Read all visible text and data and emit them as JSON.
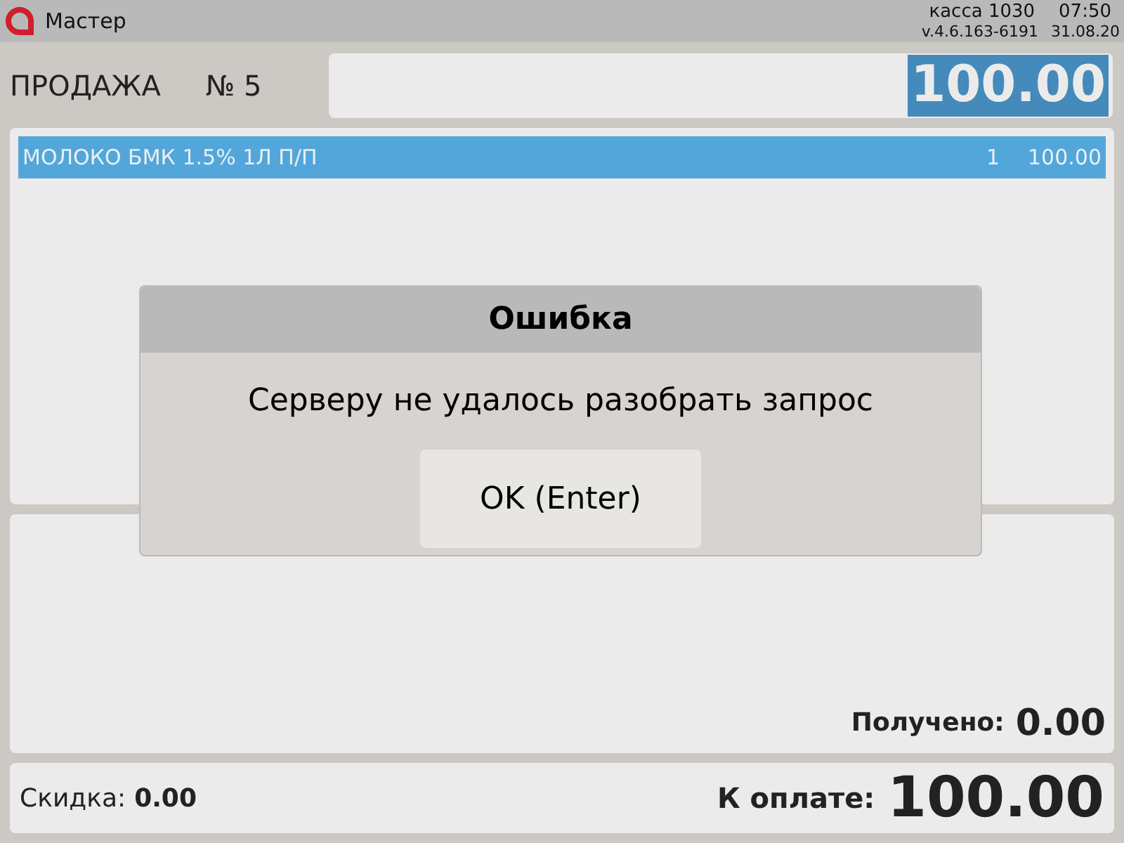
{
  "top_bar": {
    "app_name": "Мастер",
    "register": "касса 1030",
    "time": "07:50",
    "version": "v.4.6.163-6191",
    "date": "31.08.20"
  },
  "sale": {
    "title": "ПРОДАЖА",
    "number": "№ 5",
    "total": "100.00"
  },
  "items": [
    {
      "name": "МОЛОКО БМК 1.5% 1Л П/П",
      "quantity": "1",
      "price": "100.00",
      "selected": true
    }
  ],
  "payment": {
    "received_label": "Получено:",
    "received": "0.00"
  },
  "summary": {
    "discount_label": "Скидка:",
    "discount": "0.00",
    "due_label": "К оплате:",
    "due": "100.00"
  },
  "dialog": {
    "title": "Ошибка",
    "message": "Серверу не удалось разобрать запрос",
    "buttons": [
      "OK (Enter)"
    ]
  }
}
